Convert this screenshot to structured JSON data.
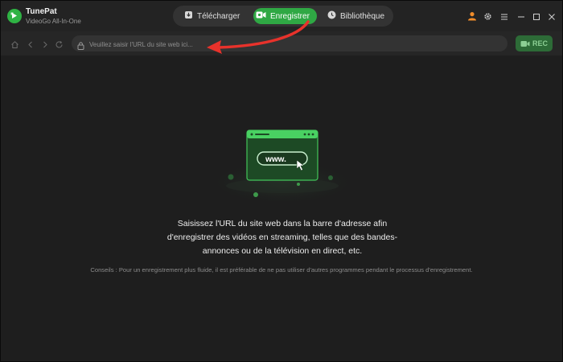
{
  "app": {
    "name": "TunePat",
    "subtitle": "VideoGo All-In-One"
  },
  "tabs": [
    {
      "label": "Télécharger",
      "icon": "download-icon",
      "active": false
    },
    {
      "label": "Enregistrer",
      "icon": "record-icon",
      "active": true
    },
    {
      "label": "Bibliothèque",
      "icon": "library-icon",
      "active": false
    }
  ],
  "window_controls": [
    "user-icon",
    "gear-icon",
    "menu-icon",
    "minimize-icon",
    "maximize-icon",
    "close-icon"
  ],
  "addressbar": {
    "url_value": "",
    "placeholder": "Veuillez saisir l'URL du site web ici...",
    "rec_label": "REC"
  },
  "illustration": {
    "text": "www."
  },
  "main": {
    "message_line1": "Saisissez l'URL du site web dans la barre d'adresse afin",
    "message_line2": "d'enregistrer des vidéos en streaming, telles que des bandes-",
    "message_line3": "annonces ou de la télévision en direct, etc.",
    "tip": "Conseils : Pour un enregistrement plus fluide, il est préférable de ne pas utiliser d'autres programmes pendant le processus d'enregistrement."
  },
  "colors": {
    "accent": "#2fa844",
    "background": "#1e1e1e",
    "arrow": "#e8322b",
    "user_icon": "#f08c2a"
  }
}
